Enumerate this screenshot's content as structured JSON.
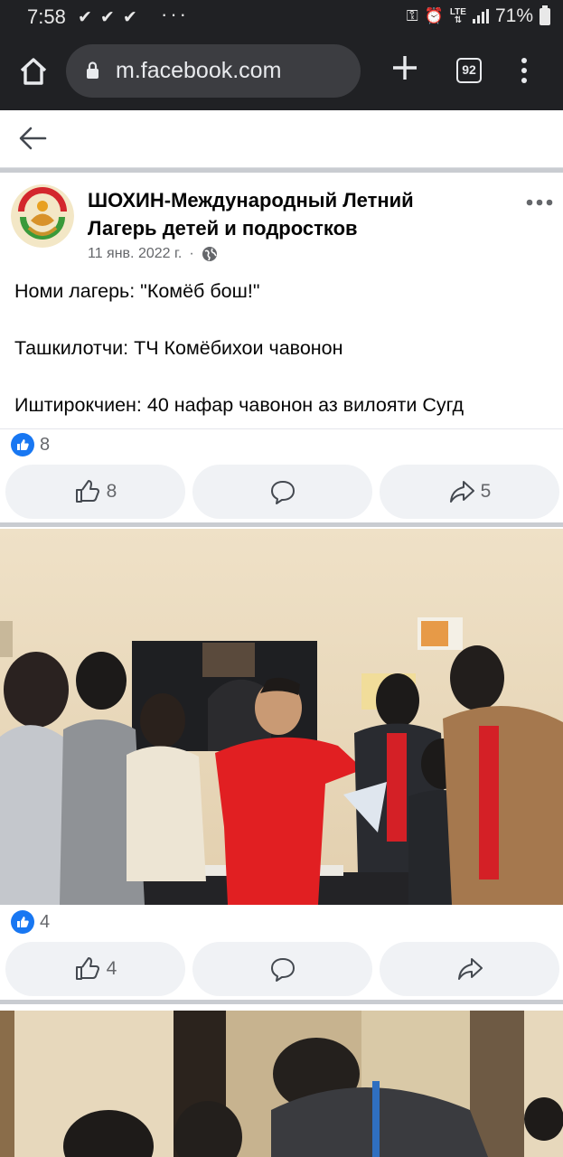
{
  "status_bar": {
    "time": "7:58",
    "checks": "✔✔✔",
    "dots": "···",
    "lte": "LTE",
    "battery": "71%"
  },
  "browser": {
    "url": "m.facebook.com",
    "tab_count": "92"
  },
  "post": {
    "page_name": "ШОХИН-Международный Летний Лагерь детей и подростков",
    "date": "11 янв. 2022 г.",
    "meta_separator": "·",
    "lines": [
      "Номи лагерь: \"Комёб бош!\"",
      "Ташкилотчи: ТЧ Комёбихои чавонон",
      "Иштирокчиен: 40 нафар чавонон аз вилояти Сугд"
    ],
    "reaction_count": "8",
    "actions": {
      "like_count": "8",
      "share_count": "5"
    }
  },
  "photo_post_1": {
    "reaction_count": "4",
    "actions": {
      "like_count": "4"
    }
  },
  "colors": {
    "facebook_blue": "#1877f2",
    "browser_bg": "#202124",
    "action_bg": "#f0f2f5",
    "secondary_text": "#65676b"
  }
}
